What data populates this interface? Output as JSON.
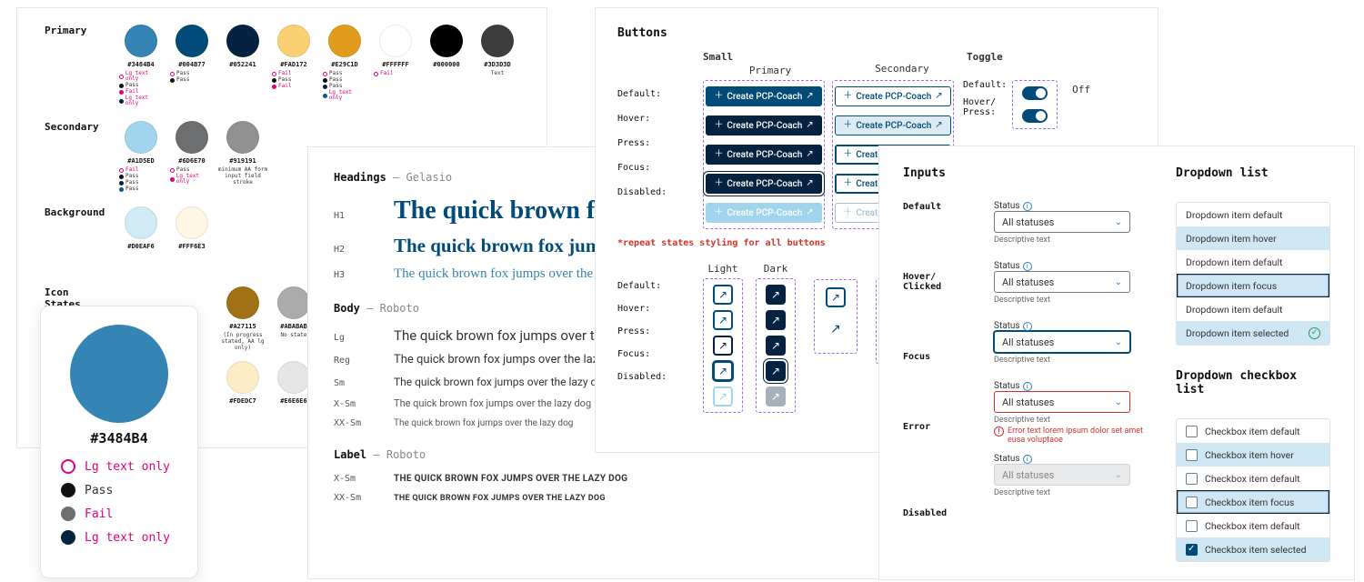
{
  "colors": {
    "primary_label": "Primary",
    "secondary_label": "Secondary",
    "background_label": "Background",
    "icon_states_label": "Icon\nStates",
    "primary": [
      {
        "hex": "#3484B4",
        "checks": [
          {
            "style": "outline",
            "txt": "Lg text only",
            "pink": true
          },
          {
            "style": "pass",
            "txt": "Pass"
          },
          {
            "style": "fail",
            "txt": "Fail",
            "pink": true
          },
          {
            "style": "navy",
            "txt": "Lg text only",
            "pink": true
          }
        ]
      },
      {
        "hex": "#004B77",
        "checks": [
          {
            "style": "outline",
            "txt": "Pass"
          },
          {
            "style": "pass",
            "txt": "Pass"
          }
        ]
      },
      {
        "hex": "#052241",
        "checks": []
      },
      {
        "hex": "#FAD172",
        "checks": [
          {
            "style": "outline",
            "txt": "Fail",
            "pink": true
          },
          {
            "style": "pass",
            "txt": "Pass"
          },
          {
            "style": "fail",
            "txt": "Fail",
            "pink": true
          }
        ]
      },
      {
        "hex": "#E29C1D",
        "checks": [
          {
            "style": "outline",
            "txt": "Pass"
          },
          {
            "style": "pass",
            "txt": "Pass"
          },
          {
            "style": "navy",
            "txt": "Pass"
          },
          {
            "style": "teal",
            "txt": "Lg text only",
            "pink": true
          }
        ]
      },
      {
        "hex": "#FFFFFF",
        "checks": [
          {
            "style": "outline",
            "txt": "Fail",
            "pink": true
          }
        ]
      },
      {
        "hex": "#000000",
        "checks": []
      },
      {
        "hex": "#3D3D3D",
        "note": "Text",
        "checks": []
      }
    ],
    "secondary": [
      {
        "hex": "#A1D5ED",
        "checks": [
          {
            "style": "outline",
            "txt": "Fail",
            "pink": true
          },
          {
            "style": "pass",
            "txt": "Pass"
          },
          {
            "style": "navy",
            "txt": "Pass"
          },
          {
            "style": "teal",
            "txt": "Pass"
          }
        ]
      },
      {
        "hex": "#6D6E70",
        "checks": [
          {
            "style": "outline",
            "txt": "Pass"
          },
          {
            "style": "fail",
            "txt": "Lg text only",
            "pink": true
          }
        ]
      },
      {
        "hex": "#919191",
        "note": "minimum AA form\ninput field stroke",
        "checks": []
      }
    ],
    "background": [
      {
        "hex": "#D0EAF6",
        "checks": []
      },
      {
        "hex": "#FFF6E3",
        "checks": []
      }
    ],
    "icon": [
      {
        "hex": "#A27115",
        "note": "(In progress\nstated, AA lg only)"
      },
      {
        "hex": "#ABABAB",
        "note": "No state"
      },
      {
        "hex": "#FDEDC7"
      },
      {
        "hex": "#E6E6E6"
      }
    ],
    "zoom": {
      "hex": "#3484B4",
      "legend": [
        {
          "txt": "Lg text only",
          "pink": true,
          "ring": true,
          "bg": "#ffffff"
        },
        {
          "txt": "Pass",
          "bg": "#111111"
        },
        {
          "txt": "Fail",
          "pink": true,
          "bg": "#6d6e70"
        },
        {
          "txt": "Lg text only",
          "pink": true,
          "bg": "#052241"
        }
      ]
    }
  },
  "typography": {
    "headings_title": "Headings",
    "headings_family": "Gelasio",
    "body_title": "Body",
    "body_family": "Roboto",
    "label_title": "Label",
    "label_family": "Roboto",
    "rows": {
      "h1": "H1",
      "h2": "H2",
      "h3": "H3",
      "lg": "Lg",
      "reg": "Reg",
      "sm": "Sm",
      "xsm": "X-Sm",
      "xxsm": "XX-Sm",
      "lxsm": "X-Sm",
      "lxxsm": "XX-Sm"
    },
    "sample": "The quick brown fox jumps over the lazy dog",
    "sample_upper": "THE QUICK BROWN FOX JUMPS OVER THE LAZY DOG"
  },
  "buttons": {
    "title": "Buttons",
    "small": "Small",
    "primary": "Primary",
    "secondary": "Secondary",
    "toggle": "Toggle",
    "off": "Off",
    "states": {
      "default": "Default:",
      "hover": "Hover:",
      "press": "Press:",
      "focus": "Focus:",
      "disabled": "Disabled:",
      "hover_press": "Hover/\nPress:"
    },
    "cta": "Create PCP-Coach",
    "repeat": "*repeat states styling for all buttons",
    "light": "Light",
    "dark": "Dark"
  },
  "inputs": {
    "title": "Inputs",
    "dropdown_title": "Dropdown list",
    "checkbox_title": "Dropdown checkbox list",
    "label": "Status",
    "placeholder": "All statuses",
    "descriptive": "Descriptive text",
    "error": "Error text lorem ipsum dolor set amet eusa voluptaoe",
    "row_states": {
      "default": "Default",
      "hover": "Hover/\nClicked",
      "focus": "Focus",
      "error": "Error",
      "disabled": "Disabled"
    },
    "dd_items": [
      "Dropdown item default",
      "Dropdown item hover",
      "Dropdown item default",
      "Dropdown item focus",
      "Dropdown item default",
      "Dropdown item selected"
    ],
    "cb_items": [
      "Checkbox item default",
      "Checkbox item hover",
      "Checkbox item default",
      "Checkbox item focus",
      "Checkbox item default",
      "Checkbox item selected"
    ]
  }
}
